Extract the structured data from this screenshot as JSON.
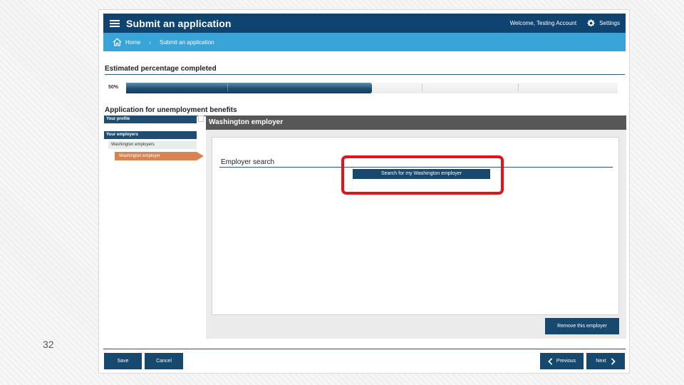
{
  "slide": {
    "number": "32"
  },
  "app": {
    "title": "Submit an application",
    "welcome": "Welcome, Testing Account",
    "settings_label": "Settings"
  },
  "breadcrumb": {
    "home": "Home",
    "current": "Submit an application"
  },
  "progress": {
    "heading": "Estimated percentage completed",
    "percent_label": "50%",
    "percent": 50
  },
  "application": {
    "heading": "Application for unemployment benefits"
  },
  "sidebar": {
    "items": [
      {
        "label": "Your profile"
      },
      {
        "label": "Your employers"
      },
      {
        "label": "Washington employers"
      },
      {
        "label": "Washington employer"
      }
    ]
  },
  "panel": {
    "title": "Washington employer",
    "section_title": "Employer search",
    "search_button": "Search for my Washington employer",
    "remove_button": "Remove this employer"
  },
  "footer": {
    "save": "Save",
    "cancel": "Cancel",
    "previous": "Previous",
    "next": "Next"
  },
  "colors": {
    "appbar": "#0f4470",
    "breadcrumb_bar": "#38a4d8",
    "active_nav": "#d9834f",
    "button": "#17486e",
    "highlight": "#e0141c"
  }
}
